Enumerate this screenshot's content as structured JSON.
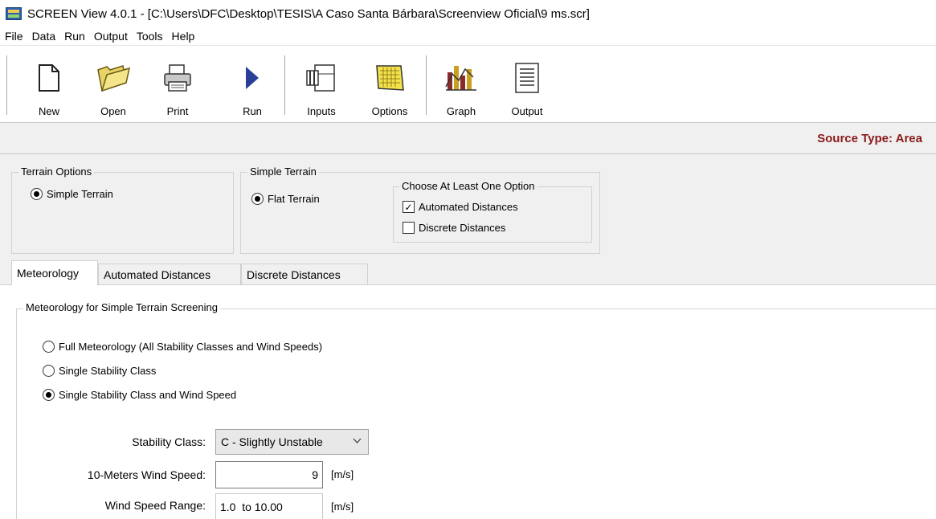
{
  "window": {
    "title": "SCREEN View 4.0.1 - [C:\\Users\\DFC\\Desktop\\TESIS\\A Caso Santa Bárbara\\Screenview Oficial\\9 ms.scr]"
  },
  "menu": {
    "items": [
      "File",
      "Data",
      "Run",
      "Output",
      "Tools",
      "Help"
    ]
  },
  "toolbar": {
    "new_label": "New",
    "open_label": "Open",
    "print_label": "Print",
    "run_label": "Run",
    "inputs_label": "Inputs",
    "options_label": "Options",
    "graph_label": "Graph",
    "output_label": "Output"
  },
  "status": {
    "source_type": "Source Type: Area"
  },
  "terrain_options": {
    "label": "Terrain Options",
    "simple_terrain": "Simple Terrain"
  },
  "simple_terrain": {
    "label": "Simple Terrain",
    "flat_terrain": "Flat Terrain",
    "choose_label": "Choose At Least One Option",
    "automated": "Automated Distances",
    "discrete": "Discrete Distances"
  },
  "tabs": [
    "Meteorology",
    "Automated Distances",
    "Discrete Distances"
  ],
  "meteorology": {
    "group_label": "Meteorology for Simple Terrain Screening",
    "opt_full": "Full Meteorology (All Stability Classes and Wind Speeds)",
    "opt_single": "Single Stability Class",
    "opt_single_wind": "Single Stability Class and Wind Speed",
    "stability_label": "Stability Class:",
    "stability_value": "C - Slightly Unstable",
    "wind_speed_label": "10-Meters Wind Speed:",
    "wind_speed_value": "9",
    "wind_speed_unit": "[m/s]",
    "range_label": "Wind Speed Range:",
    "range_value": "1.0  to 10.00",
    "range_unit": "[m/s]"
  },
  "colors": {
    "source_type": "#8b1a1a",
    "run_arrow": "#2a3f9a"
  }
}
